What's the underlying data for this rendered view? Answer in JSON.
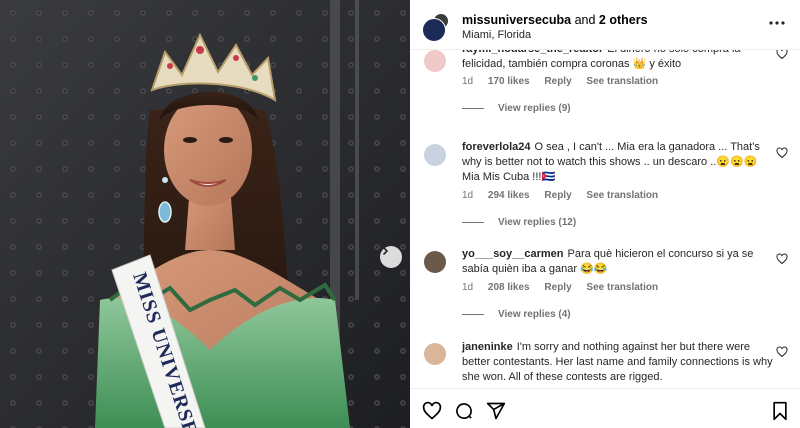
{
  "header": {
    "username": "missuniversecuba",
    "and_text": " and ",
    "others": "2 others",
    "location": "Miami, Florida"
  },
  "sash_text": "MISS UNIVERSE",
  "comments": [
    {
      "username": "raymi_nodarse_the_realtor",
      "text": "El dinero no solo compra la felicidad, también compra coronas 👑 y éxito",
      "time": "1d",
      "likes": "170 likes",
      "reply": "Reply",
      "translate": "See translation",
      "view_replies": "View replies (9)"
    },
    {
      "username": "foreverlola24",
      "text": "O sea , I can't ... Mia era la ganadora ... That's why is better not to watch this shows .. un descaro ..😦😦😦 Mia Mis Cuba !!!🇨🇺",
      "time": "1d",
      "likes": "294 likes",
      "reply": "Reply",
      "translate": "See translation",
      "view_replies": "View replies (12)"
    },
    {
      "username": "yo___soy__carmen",
      "text": "Para què hicieron el concurso si ya se sabía quièn iba a ganar 😂😂",
      "time": "1d",
      "likes": "208 likes",
      "reply": "Reply",
      "translate": "See translation",
      "view_replies": "View replies (4)"
    },
    {
      "username": "janeninke",
      "text": "I'm sorry and nothing against her but there were better contestants. Her last name and family connections is why she won. All of these contests are rigged.",
      "time": "",
      "likes": "",
      "reply": "",
      "translate": "",
      "view_replies": ""
    }
  ],
  "icons": {
    "heart": "heart-icon",
    "comment": "comment-icon",
    "share": "share-icon",
    "bookmark": "bookmark-icon",
    "more": "more-icon",
    "next": "chevron-right-icon"
  },
  "colors": {
    "secondary_text": "#737373",
    "primary_text": "#262626",
    "divider": "#efefef"
  }
}
